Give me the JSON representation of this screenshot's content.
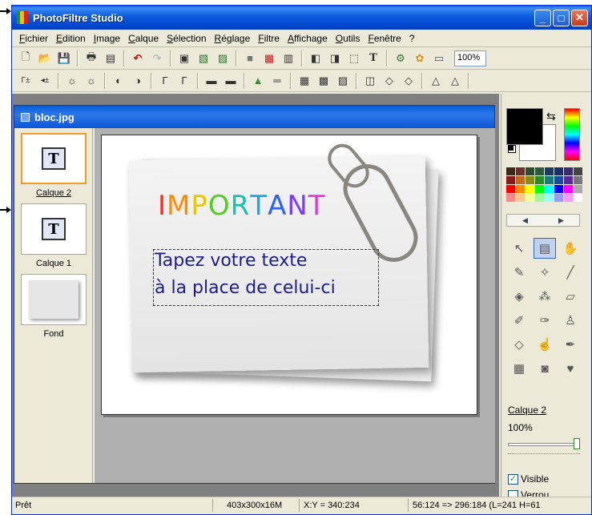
{
  "window": {
    "title": "PhotoFiltre Studio"
  },
  "menu": [
    "Fichier",
    "Edition",
    "Image",
    "Calque",
    "Sélection",
    "Réglage",
    "Filtre",
    "Affichage",
    "Outils",
    "Fenêtre",
    "?"
  ],
  "toolbar": {
    "zoom": "100%"
  },
  "document": {
    "title": "bloc.jpg",
    "layers": [
      {
        "label": "Calque 2",
        "selected": true
      },
      {
        "label": "Calque 1",
        "selected": false
      },
      {
        "label": "Fond",
        "selected": false
      }
    ],
    "canvas": {
      "headline": "IMPORTANT",
      "headline_colors": [
        "#ff2a1a",
        "#ff8a00",
        "#e8c900",
        "#4ecf1f",
        "#16c4b0",
        "#1aa8e8",
        "#2a62ff",
        "#7a3cff",
        "#e236e0"
      ],
      "body_line_1": "Tapez votre texte",
      "body_line_2": "à la place de celui-ci",
      "text_color": "#1d1c8c"
    }
  },
  "palette": {
    "foreground": "#000000",
    "background": "#ffffff",
    "swatches": [
      "#3a2a1a",
      "#6b2c2c",
      "#2c4a2c",
      "#2a5a3a",
      "#1d3a5a",
      "#1c2c6a",
      "#3a2a6a",
      "#444444",
      "#8a1a1a",
      "#c06a1a",
      "#8a8a1a",
      "#2a8a2a",
      "#1a7a7a",
      "#1a4a9a",
      "#5a2a9a",
      "#777777",
      "#ff0000",
      "#ff8a00",
      "#ffff00",
      "#00ff00",
      "#00ffff",
      "#0000ff",
      "#ff00ff",
      "#aaaaaa",
      "#ff8a8a",
      "#ffc88a",
      "#ffff9a",
      "#9aff9a",
      "#9affff",
      "#9a9aff",
      "#ff9aff",
      "#ffffff"
    ],
    "layer_name": "Calque 2",
    "opacity": "100%",
    "visible_label": "Visible",
    "visible_checked": true,
    "lock_label": "Verrou",
    "lock_checked": false
  },
  "status": {
    "state": "Prêt",
    "size": "403x300x16M",
    "coords": "X:Y = 340:234",
    "selection": "56:124 => 296:184 (L=241  H=61"
  }
}
